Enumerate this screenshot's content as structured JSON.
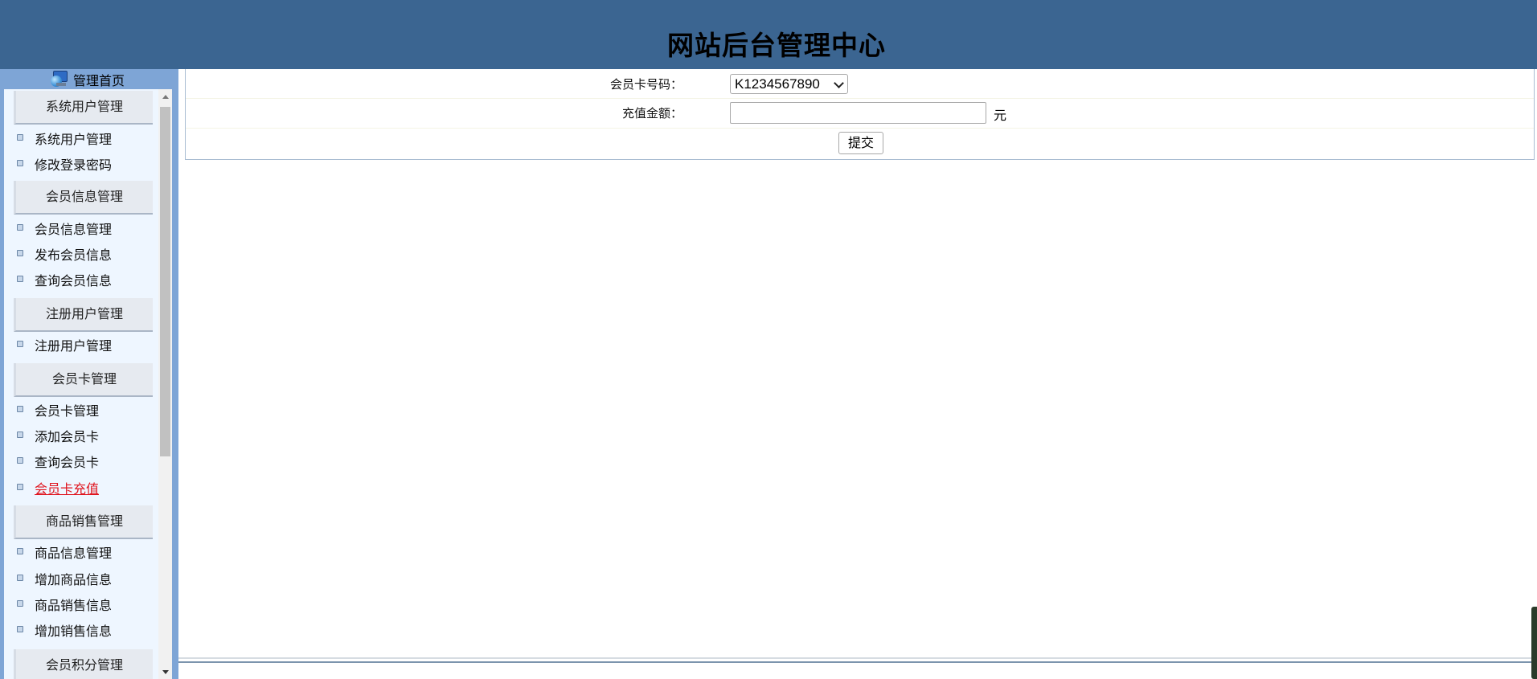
{
  "header": {
    "title": "网站后台管理中心"
  },
  "sidebar": {
    "home": {
      "label": "管理首页",
      "icon": "computer-globe-icon"
    },
    "groups": [
      {
        "title": "系统用户管理",
        "items": [
          "系统用户管理",
          "修改登录密码"
        ]
      },
      {
        "title": "会员信息管理",
        "items": [
          "会员信息管理",
          "发布会员信息",
          "查询会员信息"
        ]
      },
      {
        "title": "注册用户管理",
        "items": [
          "注册用户管理"
        ]
      },
      {
        "title": "会员卡管理",
        "items": [
          "会员卡管理",
          "添加会员卡",
          "查询会员卡",
          "会员卡充值"
        ]
      },
      {
        "title": "商品销售管理",
        "items": [
          "商品信息管理",
          "增加商品信息",
          "商品销售信息",
          "增加销售信息"
        ]
      },
      {
        "title": "会员积分管理",
        "items": []
      }
    ],
    "active_item": "会员卡充值"
  },
  "form": {
    "card_label": "会员卡号码：",
    "card_value": "K1234567890",
    "amount_label": "充值金额：",
    "amount_value": "",
    "unit": "元",
    "submit_label": "提交"
  },
  "colors": {
    "header_bg": "#3b6591",
    "sidebar_bg": "#7ea5d6",
    "menu_bg": "#eef6ff",
    "active_link": "#e0151f"
  }
}
